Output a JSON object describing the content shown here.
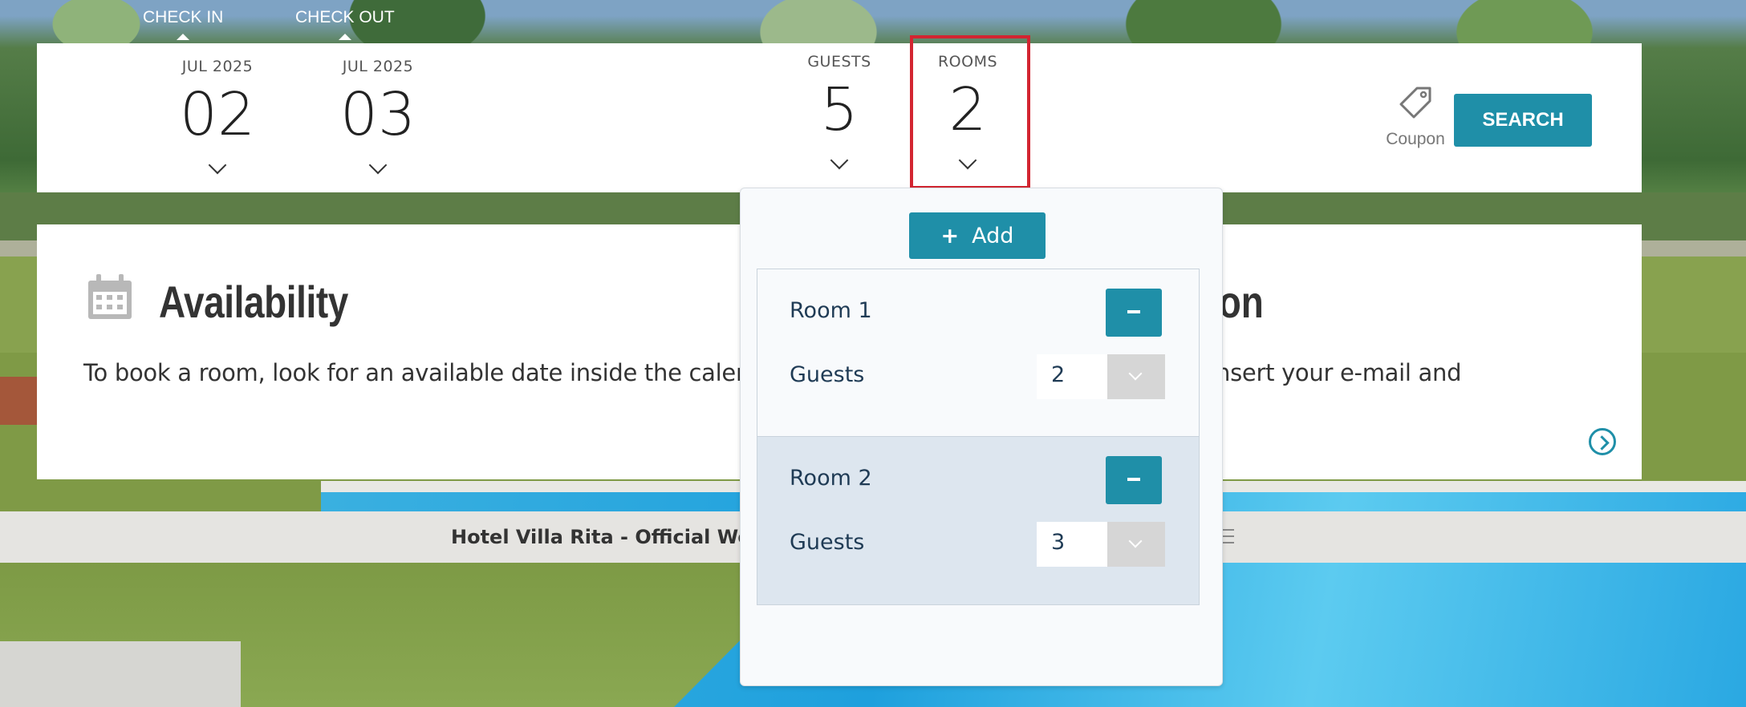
{
  "booking_bar": {
    "checkin_label": "CHECK IN",
    "checkout_label": "CHECK OUT",
    "checkin": {
      "month_year": "JUL 2025",
      "day": "02"
    },
    "checkout": {
      "month_year": "JUL 2025",
      "day": "03"
    },
    "guests": {
      "label": "GUESTS",
      "value": "5"
    },
    "rooms": {
      "label": "ROOMS",
      "value": "2"
    },
    "coupon_label": "Coupon",
    "search_label": "SEARCH",
    "accent_color": "#1f8fa8",
    "highlight_color": "#d32531"
  },
  "availability_card": {
    "title": "Availability",
    "title_right_fragment": "ion",
    "text_left": "To book a room, look for an available date inside the calend",
    "text_right": "se insert your e-mail and"
  },
  "footer_strip": {
    "text": "Hotel Villa Rita - Official Websi"
  },
  "rooms_dropdown": {
    "add_label": "Add",
    "rooms": [
      {
        "label": "Room 1",
        "guests_label": "Guests",
        "guests_value": "2"
      },
      {
        "label": "Room 2",
        "guests_label": "Guests",
        "guests_value": "3"
      }
    ]
  }
}
